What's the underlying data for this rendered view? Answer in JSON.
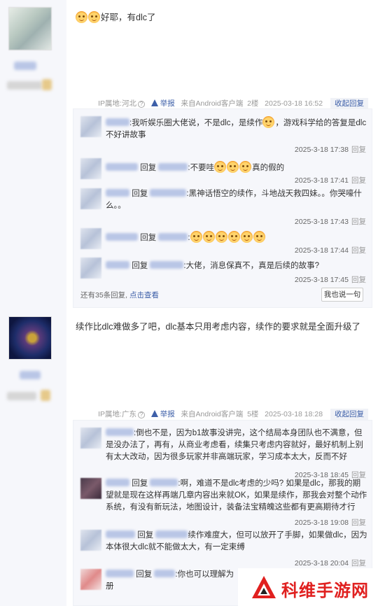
{
  "posts": [
    {
      "text": "好耶，有dlc了",
      "emoji_count": 2
    },
    {
      "text": "续作比dlc难做多了吧，dlc基本只用考虑内容，续作的要求就是全面升级了"
    }
  ],
  "threads": [
    {
      "meta": {
        "ip": "IP属地:河北",
        "report": "举报",
        "source": "来自Android客户端",
        "floor": "2楼",
        "time": "2025-03-18 16:52",
        "fold": "收起回复"
      },
      "replies": [
        {
          "text": ":我听娱乐圈大佬说，不是dlc，是续作",
          "text2": "，游戏科学给的答复是dlc不好讲故事",
          "time": "2025-3-18 17:38",
          "reply": "回复"
        },
        {
          "prefix": "回复",
          "text": ":不要哇",
          "text2": "真的假的",
          "time": "2025-3-18 17:41",
          "reply": "回复"
        },
        {
          "prefix": "回复",
          "text": ":黑神话悟空的续作，斗地战天救四妹。。你哭嚎什么。。",
          "time": "2025-3-18 17:43",
          "reply": "回复"
        },
        {
          "prefix": "回复",
          "text": ":",
          "time": "2025-3-18 17:44",
          "reply": "回复"
        },
        {
          "prefix": "回复",
          "text": ":大佬，消息保真不，真是后续的故事?",
          "time": "2025-3-18 17:45",
          "reply": "回复"
        }
      ],
      "more": "还有35条回复,",
      "view": "点击查看",
      "say": "我也说一句"
    },
    {
      "meta": {
        "ip": "IP属地:广东",
        "report": "举报",
        "source": "来自Android客户端",
        "floor": "5楼",
        "time": "2025-03-18 18:28",
        "fold": "收起回复"
      },
      "replies": [
        {
          "text": ":倒也不是，因为b1故事没讲完，这个结局本身团队也不满意，但是没办法了，再有，从商业考虑看，续集只考虑内容就好，最好机制上别有太大改动，因为很多玩家并非高端玩家，学习成本太大，反而不好",
          "time": "2025-3-18 18:45",
          "reply": "回复"
        },
        {
          "prefix": "回复",
          "text": ":啊，难道不是dlc考虑的少吗? 如果是dlc，那我的期望就是现在这样再端几章内容出来就OK，如果是续作，那我会对整个动作系统，有没有新玩法，地图设计，装备法宝精魄这些都有更高期待才行",
          "time": "2025-3-18 19:08",
          "reply": "回复"
        },
        {
          "prefix": "回复",
          "text": "续作难度大，但可以放开了手脚，如果做dlc，因为本体很大dlc就不能做太大，有一定束缚",
          "time": "2025-3-18 20:04",
          "reply": "回复"
        },
        {
          "prefix": "回复",
          "text": ":你也可以理解为",
          "text2": "册"
        }
      ]
    }
  ],
  "watermark": {
    "text": "科维手游网"
  },
  "colors": {
    "link": "#3d5fa8",
    "watermark": "#e0201f",
    "reply_bg": "#f6f7fb"
  }
}
